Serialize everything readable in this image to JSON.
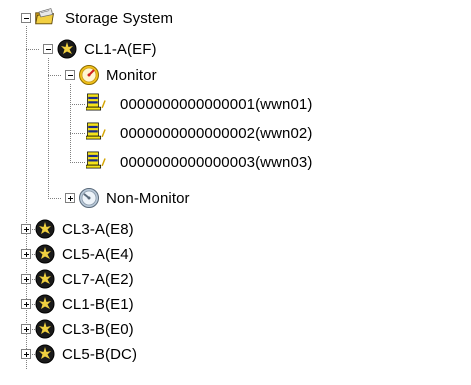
{
  "tree": {
    "root": {
      "label": "Storage System",
      "icon": "storage-system-folder-icon",
      "expanded": true
    },
    "ports": [
      {
        "label": "CL1-A(EF)",
        "icon": "port-icon",
        "expanded": true
      },
      {
        "label": "CL3-A(E8)",
        "icon": "port-icon",
        "expanded": false
      },
      {
        "label": "CL5-A(E4)",
        "icon": "port-icon",
        "expanded": false
      },
      {
        "label": "CL7-A(E2)",
        "icon": "port-icon",
        "expanded": false
      },
      {
        "label": "CL1-B(E1)",
        "icon": "port-icon",
        "expanded": false
      },
      {
        "label": "CL3-B(E0)",
        "icon": "port-icon",
        "expanded": false
      },
      {
        "label": "CL5-B(DC)",
        "icon": "port-icon",
        "expanded": false
      }
    ],
    "monitor": {
      "label": "Monitor",
      "icon": "monitor-gauge-icon",
      "expanded": true
    },
    "wwns": [
      {
        "label": "0000000000000001(wwn01)",
        "icon": "host-wwn-icon"
      },
      {
        "label": "0000000000000002(wwn02)",
        "icon": "host-wwn-icon"
      },
      {
        "label": "0000000000000003(wwn03)",
        "icon": "host-wwn-icon"
      }
    ],
    "non_monitor": {
      "label": "Non-Monitor",
      "icon": "non-monitor-gauge-icon",
      "expanded": false
    }
  },
  "colors": {
    "tree_line": "#808080",
    "folder": "#e8c23a",
    "port_body": "#1a1a1a",
    "port_burst": "#f0d040",
    "gauge_active": "#f2c21a",
    "gauge_needle": "#d02020",
    "gauge_inactive": "#b8c8d8",
    "wwn_yellow": "#f5e31a"
  }
}
